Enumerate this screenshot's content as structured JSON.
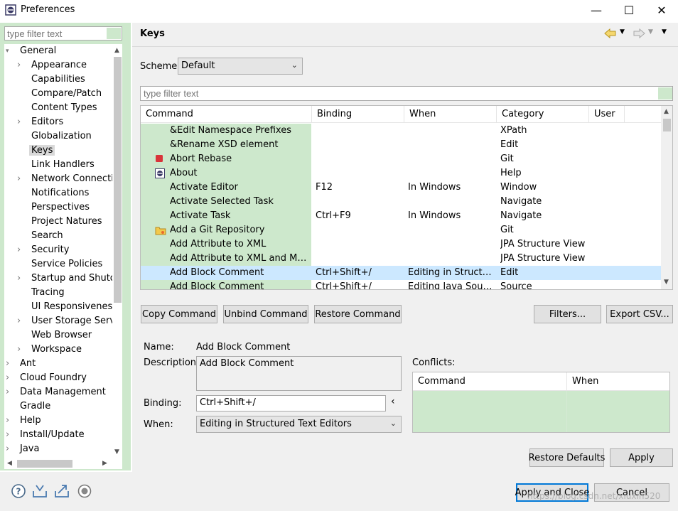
{
  "window": {
    "title": "Preferences",
    "controls": [
      "—",
      "☐",
      "✕"
    ]
  },
  "left": {
    "filter_placeholder": "type filter text",
    "tree": [
      {
        "label": "General",
        "level": 0,
        "expanded": true
      },
      {
        "label": "Appearance",
        "level": 1,
        "children": true
      },
      {
        "label": "Capabilities",
        "level": 1
      },
      {
        "label": "Compare/Patch",
        "level": 1
      },
      {
        "label": "Content Types",
        "level": 1
      },
      {
        "label": "Editors",
        "level": 1,
        "children": true
      },
      {
        "label": "Globalization",
        "level": 1
      },
      {
        "label": "Keys",
        "level": 1,
        "selected": true
      },
      {
        "label": "Link Handlers",
        "level": 1
      },
      {
        "label": "Network Connectio",
        "level": 1,
        "children": true
      },
      {
        "label": "Notifications",
        "level": 1
      },
      {
        "label": "Perspectives",
        "level": 1
      },
      {
        "label": "Project Natures",
        "level": 1
      },
      {
        "label": "Search",
        "level": 1
      },
      {
        "label": "Security",
        "level": 1,
        "children": true
      },
      {
        "label": "Service Policies",
        "level": 1
      },
      {
        "label": "Startup and Shutdo",
        "level": 1,
        "children": true
      },
      {
        "label": "Tracing",
        "level": 1
      },
      {
        "label": "UI Responsiveness",
        "level": 1
      },
      {
        "label": "User Storage Servic",
        "level": 1,
        "children": true
      },
      {
        "label": "Web Browser",
        "level": 1
      },
      {
        "label": "Workspace",
        "level": 1,
        "children": true
      },
      {
        "label": "Ant",
        "level": 0,
        "children": true
      },
      {
        "label": "Cloud Foundry",
        "level": 0,
        "children": true
      },
      {
        "label": "Data Management",
        "level": 0,
        "children": true
      },
      {
        "label": "Gradle",
        "level": 0
      },
      {
        "label": "Help",
        "level": 0,
        "children": true
      },
      {
        "label": "Install/Update",
        "level": 0,
        "children": true
      },
      {
        "label": "Java",
        "level": 0,
        "children": true
      }
    ]
  },
  "page": {
    "title": "Keys",
    "scheme_label": "Scheme:",
    "scheme_value": "Default",
    "filter_placeholder": "type filter text",
    "columns": [
      "Command",
      "Binding",
      "When",
      "Category",
      "User"
    ],
    "rows": [
      {
        "icon": "",
        "command": "&Edit Namespace Prefixes",
        "binding": "",
        "when": "",
        "category": "XPath",
        "user": ""
      },
      {
        "icon": "",
        "command": "&Rename XSD element",
        "binding": "",
        "when": "",
        "category": "Edit",
        "user": ""
      },
      {
        "icon": "stop-icon",
        "command": "Abort Rebase",
        "binding": "",
        "when": "",
        "category": "Git",
        "user": ""
      },
      {
        "icon": "eclipse-icon",
        "command": "About",
        "binding": "",
        "when": "",
        "category": "Help",
        "user": ""
      },
      {
        "icon": "",
        "command": "Activate Editor",
        "binding": "F12",
        "when": "In Windows",
        "category": "Window",
        "user": ""
      },
      {
        "icon": "",
        "command": "Activate Selected Task",
        "binding": "",
        "when": "",
        "category": "Navigate",
        "user": ""
      },
      {
        "icon": "",
        "command": "Activate Task",
        "binding": "Ctrl+F9",
        "when": "In Windows",
        "category": "Navigate",
        "user": ""
      },
      {
        "icon": "git-repo-icon",
        "command": "Add a Git Repository",
        "binding": "",
        "when": "",
        "category": "Git",
        "user": ""
      },
      {
        "icon": "",
        "command": "Add Attribute to XML",
        "binding": "",
        "when": "",
        "category": "JPA Structure View",
        "user": ""
      },
      {
        "icon": "",
        "command": "Add Attribute to XML and Map...",
        "binding": "",
        "when": "",
        "category": "JPA Structure View",
        "user": ""
      },
      {
        "icon": "",
        "command": "Add Block Comment",
        "binding": "Ctrl+Shift+/",
        "when": "Editing in Structure...",
        "category": "Edit",
        "user": "",
        "selected": true
      },
      {
        "icon": "",
        "command": "Add Block Comment",
        "binding": "Ctrl+Shift+/",
        "when": "Editing Java Source",
        "category": "Source",
        "user": ""
      }
    ],
    "buttons": {
      "copy": "Copy Command",
      "unbind": "Unbind Command",
      "restore": "Restore Command",
      "filters": "Filters...",
      "export": "Export CSV..."
    },
    "details": {
      "name_label": "Name:",
      "name_value": "Add Block Comment",
      "description_label": "Description:",
      "description_value": "Add Block Comment",
      "binding_label": "Binding:",
      "binding_value": "Ctrl+Shift+/",
      "binding_button": "‹",
      "when_label": "When:",
      "when_value": "Editing in Structured Text Editors"
    },
    "conflicts": {
      "label": "Conflicts:",
      "columns": [
        "Command",
        "When"
      ]
    },
    "restore_defaults": "Restore Defaults",
    "apply": "Apply"
  },
  "footer": {
    "apply_close": "Apply and Close",
    "cancel": "Cancel",
    "watermark": "https://blog.csdn.net/xiuxin520"
  }
}
